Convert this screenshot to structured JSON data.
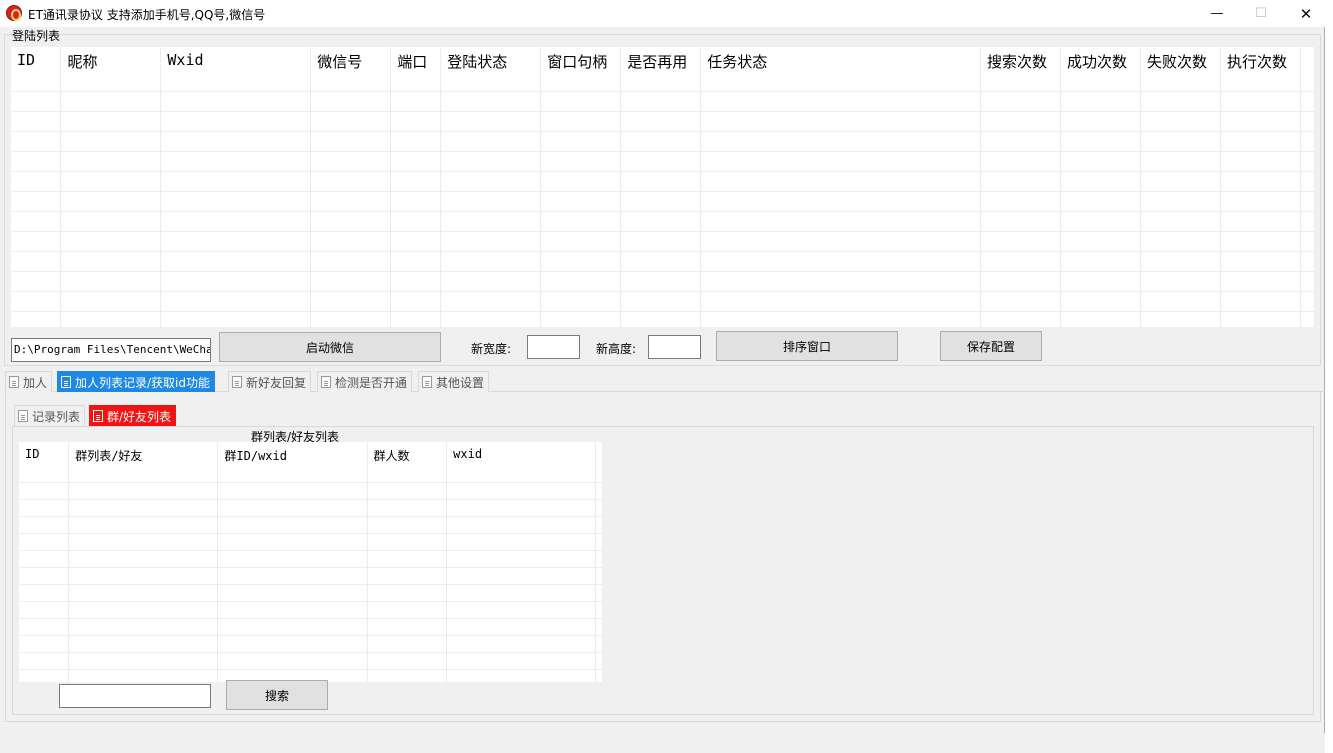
{
  "window": {
    "title": "ET通讯录协议 支持添加手机号,QQ号,微信号",
    "controls": {
      "minimize": "—",
      "maximize": "☐",
      "close": "✕"
    }
  },
  "login_group": {
    "label": "登陆列表",
    "columns": [
      "ID",
      "昵称",
      "Wxid",
      "微信号",
      "端口",
      "登陆状态",
      "窗口句柄",
      "是否再用",
      "任务状态",
      "搜索次数",
      "成功次数",
      "失败次数",
      "执行次数"
    ]
  },
  "controls_row": {
    "path_value": "D:\\Program Files\\Tencent\\WeChat",
    "start_button": "启动微信",
    "width_label": "新宽度:",
    "width_value": "",
    "height_label": "新高度:",
    "height_value": "",
    "sort_button": "排序窗口",
    "save_button": "保存配置"
  },
  "main_tabs": [
    {
      "label": "加人"
    },
    {
      "label": "加人列表记录/获取id功能"
    },
    {
      "label": "新好友回复"
    },
    {
      "label": "检测是否开通"
    },
    {
      "label": "其他设置"
    }
  ],
  "sub_tabs": [
    {
      "label": "记录列表"
    },
    {
      "label": "群/好友列表"
    }
  ],
  "group_list": {
    "caption": "群列表/好友列表",
    "columns": [
      "ID",
      "群列表/好友",
      "群ID/wxid",
      "群人数",
      "wxid"
    ]
  },
  "search": {
    "value": "",
    "button": "搜索"
  },
  "colors": {
    "active_tab_blue": "#1e88e5",
    "active_tab_red": "#f01414"
  }
}
